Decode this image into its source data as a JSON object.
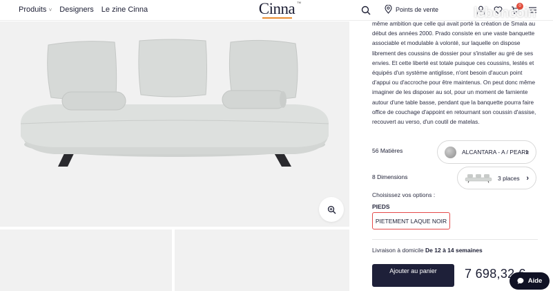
{
  "header": {
    "nav": [
      "Produits",
      "Designers",
      "Le zine Cinna"
    ],
    "logo": "Cinna",
    "logo_tm": "TM",
    "store_link": "Points de vente",
    "cart_count": "0",
    "watermark": "leboncoin"
  },
  "product": {
    "description": "même ambition que celle qui avait porté la création de Smala au début des années 2000. Prado consiste en une vaste banquette associable et modulable à volonté, sur laquelle on dispose librement des coussins de dossier pour s'installer au gré de ses envies. Et cette liberté est totale puisque ces coussins, lestés et équipés d'un système antiglisse, n'ont besoin d'aucun point d'appui ou d'accroche pour être maintenus. On peut donc même imaginer de les disposer au sol, pour un moment de farniente autour d'une table basse, pendant que la banquette pourra faire office de couchage d'appoint en retournant son coussin d'assise, recouvert au verso, d'un coutil de matelas.",
    "materials_label": "56 Matières",
    "material_value": "ALCANTARA - A / PEARL",
    "dimensions_label": "8 Dimensions",
    "dimension_value": "3 places",
    "options_label": "Choisissez vos options :",
    "feet_label": "PIEDS",
    "feet_value": "PIETEMENT LAQUE NOIR",
    "delivery_label": "Livraison à domicile",
    "delivery_value": "De 12 à 14 semaines",
    "add_to_cart": "Ajouter au panier",
    "price": "7 698,32 €"
  },
  "help_button": "Aide",
  "colors": {
    "navy": "#1e2039",
    "accent_orange": "#e88a2c",
    "selected_red": "#e44848",
    "badge_red": "#e14c3b",
    "gallery_bg": "#f1f1f1",
    "sofa_fabric": "#d9dcda"
  }
}
